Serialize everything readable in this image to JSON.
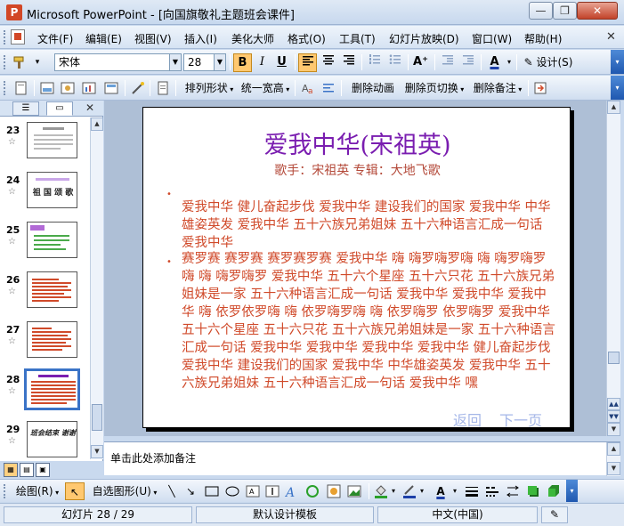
{
  "window": {
    "title": "Microsoft PowerPoint - [向国旗敬礼主题班会课件]",
    "min_label": "—",
    "max_label": "❐",
    "close_label": "✕"
  },
  "menu": {
    "items": [
      "文件(F)",
      "编辑(E)",
      "视图(V)",
      "插入(I)",
      "美化大师",
      "格式(O)",
      "工具(T)",
      "幻灯片放映(D)",
      "窗口(W)",
      "帮助(H)"
    ],
    "close_label": "✕"
  },
  "format_toolbar": {
    "font_name": "宋体",
    "font_size": "28",
    "bold": "B",
    "italic": "I",
    "underline": "U",
    "design_label": "设计(S)"
  },
  "custom_toolbar": {
    "arrange_label": "排列形状",
    "uniform_width_label": "统一宽高",
    "delete_animation_label": "删除动画",
    "delete_transition_label": "删除页切换",
    "delete_notes_label": "删除备注"
  },
  "slide_pane": {
    "thumbnails": [
      {
        "number": "23",
        "text": ""
      },
      {
        "number": "24",
        "text": "祖 国 颂 歌"
      },
      {
        "number": "25",
        "text": ""
      },
      {
        "number": "26",
        "text": ""
      },
      {
        "number": "27",
        "text": ""
      },
      {
        "number": "28",
        "text": ""
      },
      {
        "number": "29",
        "text": "班会结束 谢谢"
      }
    ],
    "selected_index": 5
  },
  "slide": {
    "title": "爱我中华(宋祖英)",
    "subtitle": "歌手：宋祖英    专辑：大地飞歌",
    "bullet_symbol": "•",
    "paragraphs": [
      "爱我中华 健儿奋起步伐 爱我中华 建设我们的国家 爱我中华 中华雄姿英发 爱我中华 五十六族兄弟姐妹 五十六种语言汇成一句话 爱我中华",
      "赛罗赛 赛罗赛 赛罗赛罗赛 爱我中华 嗨 嗨罗嗨罗嗨 嗨 嗨罗嗨罗嗨 嗨 嗨罗嗨罗 爱我中华 五十六个星座 五十六只花 五十六族兄弟姐妹是一家 五十六种语言汇成一句话 爱我中华 爱我中华 爱我中华 嗨 依罗依罗嗨 嗨 依罗嗨罗嗨 嗨 依罗嗨罗 依罗嗨罗 爱我中华 五十六个星座 五十六只花 五十六族兄弟姐妹是一家 五十六种语言汇成一句话 爱我中华 爱我中华 爱我中华 爱我中华 健儿奋起步伐 爱我中华 建设我们的国家 爱我中华 中华雄姿英发 爱我中华 五十六族兄弟姐妹 五十六种语言汇成一句话 爱我中华 嘿"
    ],
    "nav_back": "返回",
    "nav_next": "下一页"
  },
  "notes": {
    "placeholder": "单击此处添加备注"
  },
  "draw_toolbar": {
    "draw_label": "绘图(R)",
    "autoshape_label": "自选图形(U)"
  },
  "status": {
    "slide_counter": "幻灯片 28 / 29",
    "template": "默认设计模板",
    "language": "中文(中国)"
  },
  "colors": {
    "title": "#7a1db0",
    "lyrics": "#d04a2a",
    "nav": "#a5b7e8",
    "selection": "#3a73c7"
  }
}
